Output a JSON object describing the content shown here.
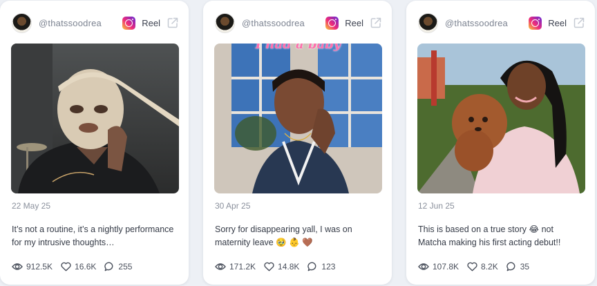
{
  "posts": [
    {
      "handle": "@thatssoodrea",
      "platform_label": "Reel",
      "date": "22 May 25",
      "caption": "It’s not a routine, it’s a nightly performance for my intrusive thoughts…",
      "views": "912.5K",
      "likes": "16.6K",
      "comments": "255"
    },
    {
      "handle": "@thatssoodrea",
      "platform_label": "Reel",
      "media_overlay_text": "I had a baby",
      "date": "30 Apr 25",
      "caption": "Sorry for disappearing yall, I was on maternity leave 🥹 👶 🤎",
      "views": "171.2K",
      "likes": "14.8K",
      "comments": "123"
    },
    {
      "handle": "@thatssoodrea",
      "platform_label": "Reel",
      "date": "12 Jun 25",
      "caption": "This is based on a true story 😂 not Matcha making his first acting debut!!",
      "views": "107.8K",
      "likes": "8.2K",
      "comments": "35"
    }
  ],
  "icons": {
    "platform": "instagram-icon",
    "open": "external-link-icon",
    "views": "eye-icon",
    "likes": "heart-icon",
    "comments": "comment-icon"
  },
  "colors": {
    "background": "#edf0f5",
    "card": "#ffffff",
    "muted_text": "#8a909c",
    "overlay_text": "#ff6fae"
  }
}
